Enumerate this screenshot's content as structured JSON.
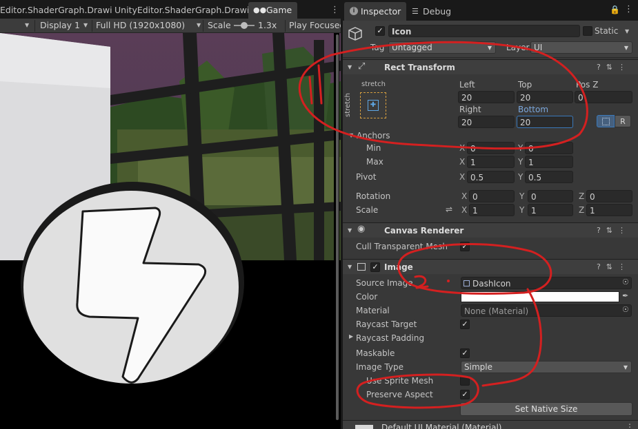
{
  "game_tabs": {
    "tab1": "Editor.ShaderGraph.Drawi",
    "tab2": "UnityEditor.ShaderGraph.Drawi",
    "tab3": "Game"
  },
  "game_toolbar": {
    "display": "Display 1",
    "resolution": "Full HD (1920x1080)",
    "scale_label": "Scale",
    "scale_value": "1.3x",
    "play_focused": "Play Focused"
  },
  "inspector_tabs": {
    "inspector": "Inspector",
    "debug": "Debug"
  },
  "object": {
    "name": "Icon",
    "static_label": "Static",
    "tag_label": "Tag",
    "tag_value": "Untagged",
    "layer_label": "Layer",
    "layer_value": "UI"
  },
  "rect_transform": {
    "title": "Rect Transform",
    "anchor_preset": "stretch",
    "anchor_preset_vertical": "stretch",
    "left_label": "Left",
    "left": "20",
    "top_label": "Top",
    "top": "20",
    "posz_label": "Pos Z",
    "posz": "0",
    "right_label": "Right",
    "right": "20",
    "bottom_label": "Bottom",
    "bottom": "20",
    "raw_button": "R",
    "anchors_label": "Anchors",
    "min_label": "Min",
    "min_x": "0",
    "min_y": "0",
    "max_label": "Max",
    "max_x": "1",
    "max_y": "1",
    "pivot_label": "Pivot",
    "pivot_x": "0.5",
    "pivot_y": "0.5",
    "rotation_label": "Rotation",
    "rot_x": "0",
    "rot_y": "0",
    "rot_z": "0",
    "scale_label": "Scale",
    "scale_x": "1",
    "scale_y": "1",
    "scale_z": "1",
    "x": "X",
    "y": "Y",
    "z": "Z"
  },
  "canvas_renderer": {
    "title": "Canvas Renderer",
    "cull_label": "Cull Transparent Mesh"
  },
  "image": {
    "title": "Image",
    "source_label": "Source Image",
    "source_value": "DashIcon",
    "color_label": "Color",
    "material_label": "Material",
    "material_value": "None (Material)",
    "raycast_target_label": "Raycast Target",
    "raycast_padding_label": "Raycast Padding",
    "maskable_label": "Maskable",
    "image_type_label": "Image Type",
    "image_type_value": "Simple",
    "use_sprite_mesh_label": "Use Sprite Mesh",
    "preserve_aspect_label": "Preserve Aspect",
    "set_native_size": "Set Native Size"
  },
  "footer": {
    "material_name": "Default UI Material (Material)"
  },
  "colors": {
    "annotation": "#d42020",
    "accent": "#3a79bb",
    "panel": "#383838"
  }
}
